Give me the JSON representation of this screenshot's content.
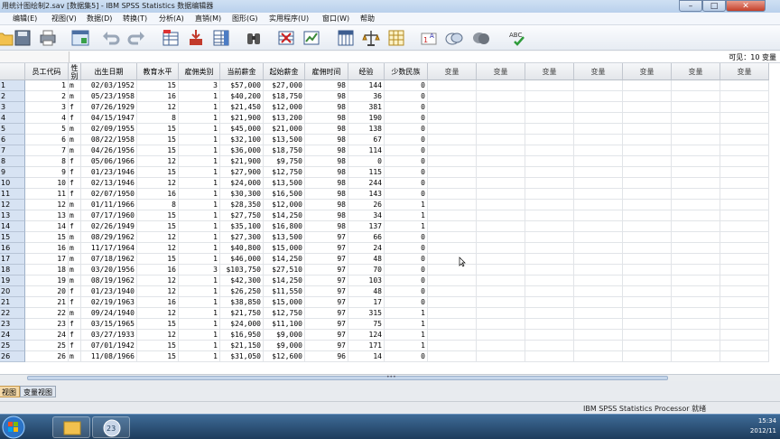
{
  "window": {
    "title": "...数据编辑器标题",
    "title_text": "用统计图绘制2.sav [数据集5] - IBM SPSS Statistics 数据编辑器"
  },
  "menu": [
    "编辑(E)",
    "视图(V)",
    "数据(D)",
    "转换(T)",
    "分析(A)",
    "直销(M)",
    "图形(G)",
    "实用程序(U)",
    "窗口(W)",
    "帮助"
  ],
  "toolbar": {
    "icons": [
      "folder-open-icon",
      "save-icon",
      "print-icon",
      "dialog-recall-icon",
      "undo-icon",
      "redo-icon",
      "goto-case-icon",
      "goto-variable-icon",
      "variables-icon",
      "find-icon",
      "insert-cases-icon",
      "insert-variable-icon",
      "split-file-icon",
      "weight-cases-icon",
      "select-cases-icon",
      "value-labels-icon",
      "use-sets-icon",
      "show-all-variables-icon",
      "spell-check-icon"
    ]
  },
  "infobar": {
    "visible_label": "可见：10 变量"
  },
  "grid": {
    "columns": [
      "员工代码",
      "性别",
      "出生日期",
      "教育水平",
      "雇佣类别",
      "当前薪金",
      "起始薪金",
      "雇佣时间",
      "经验",
      "少数民族"
    ],
    "empty_column_label": "变量",
    "empty_column_count": 7,
    "row_labels": [
      "1",
      "2",
      "3",
      "4",
      "5",
      "6",
      "7",
      "8",
      "9",
      "10",
      "11",
      "12",
      "13",
      "14",
      "15",
      "16",
      "17",
      "18",
      "19",
      "20",
      "21",
      "22",
      "23",
      "24",
      "25",
      "26"
    ],
    "rows": [
      [
        "1",
        "m",
        "02/03/1952",
        "15",
        "3",
        "$57,000",
        "$27,000",
        "98",
        "144",
        "0"
      ],
      [
        "2",
        "m",
        "05/23/1958",
        "16",
        "1",
        "$40,200",
        "$18,750",
        "98",
        "36",
        "0"
      ],
      [
        "3",
        "f",
        "07/26/1929",
        "12",
        "1",
        "$21,450",
        "$12,000",
        "98",
        "381",
        "0"
      ],
      [
        "4",
        "f",
        "04/15/1947",
        "8",
        "1",
        "$21,900",
        "$13,200",
        "98",
        "190",
        "0"
      ],
      [
        "5",
        "m",
        "02/09/1955",
        "15",
        "1",
        "$45,000",
        "$21,000",
        "98",
        "138",
        "0"
      ],
      [
        "6",
        "m",
        "08/22/1958",
        "15",
        "1",
        "$32,100",
        "$13,500",
        "98",
        "67",
        "0"
      ],
      [
        "7",
        "m",
        "04/26/1956",
        "15",
        "1",
        "$36,000",
        "$18,750",
        "98",
        "114",
        "0"
      ],
      [
        "8",
        "f",
        "05/06/1966",
        "12",
        "1",
        "$21,900",
        "$9,750",
        "98",
        "0",
        "0"
      ],
      [
        "9",
        "f",
        "01/23/1946",
        "15",
        "1",
        "$27,900",
        "$12,750",
        "98",
        "115",
        "0"
      ],
      [
        "10",
        "f",
        "02/13/1946",
        "12",
        "1",
        "$24,000",
        "$13,500",
        "98",
        "244",
        "0"
      ],
      [
        "11",
        "f",
        "02/07/1950",
        "16",
        "1",
        "$30,300",
        "$16,500",
        "98",
        "143",
        "0"
      ],
      [
        "12",
        "m",
        "01/11/1966",
        "8",
        "1",
        "$28,350",
        "$12,000",
        "98",
        "26",
        "1"
      ],
      [
        "13",
        "m",
        "07/17/1960",
        "15",
        "1",
        "$27,750",
        "$14,250",
        "98",
        "34",
        "1"
      ],
      [
        "14",
        "f",
        "02/26/1949",
        "15",
        "1",
        "$35,100",
        "$16,800",
        "98",
        "137",
        "1"
      ],
      [
        "15",
        "m",
        "08/29/1962",
        "12",
        "1",
        "$27,300",
        "$13,500",
        "97",
        "66",
        "0"
      ],
      [
        "16",
        "m",
        "11/17/1964",
        "12",
        "1",
        "$40,800",
        "$15,000",
        "97",
        "24",
        "0"
      ],
      [
        "17",
        "m",
        "07/18/1962",
        "15",
        "1",
        "$46,000",
        "$14,250",
        "97",
        "48",
        "0"
      ],
      [
        "18",
        "m",
        "03/20/1956",
        "16",
        "3",
        "$103,750",
        "$27,510",
        "97",
        "70",
        "0"
      ],
      [
        "19",
        "m",
        "08/19/1962",
        "12",
        "1",
        "$42,300",
        "$14,250",
        "97",
        "103",
        "0"
      ],
      [
        "20",
        "f",
        "01/23/1940",
        "12",
        "1",
        "$26,250",
        "$11,550",
        "97",
        "48",
        "0"
      ],
      [
        "21",
        "f",
        "02/19/1963",
        "16",
        "1",
        "$38,850",
        "$15,000",
        "97",
        "17",
        "0"
      ],
      [
        "22",
        "m",
        "09/24/1940",
        "12",
        "1",
        "$21,750",
        "$12,750",
        "97",
        "315",
        "1"
      ],
      [
        "23",
        "f",
        "03/15/1965",
        "15",
        "1",
        "$24,000",
        "$11,100",
        "97",
        "75",
        "1"
      ],
      [
        "24",
        "f",
        "03/27/1933",
        "12",
        "1",
        "$16,950",
        "$9,000",
        "97",
        "124",
        "1"
      ],
      [
        "25",
        "f",
        "07/01/1942",
        "15",
        "1",
        "$21,150",
        "$9,000",
        "97",
        "171",
        "1"
      ],
      [
        "26",
        "m",
        "11/08/1966",
        "15",
        "1",
        "$31,050",
        "$12,600",
        "96",
        "14",
        "0"
      ]
    ]
  },
  "tabs": {
    "data_view": "视图",
    "variable_view": "变量视图"
  },
  "status": {
    "text": "IBM SPSS Statistics Processor 就绪"
  },
  "taskbar": {
    "time": "15:34",
    "date": "2012/11"
  }
}
